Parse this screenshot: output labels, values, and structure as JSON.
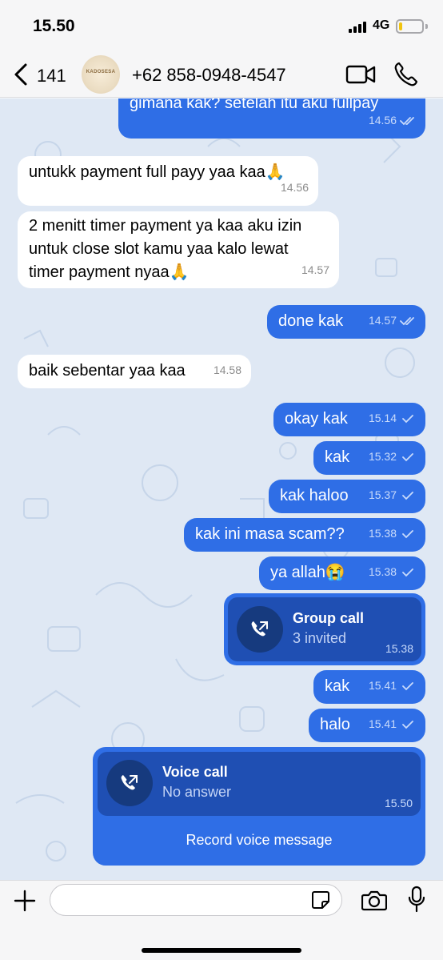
{
  "status": {
    "time": "15.50",
    "network": "4G"
  },
  "header": {
    "back_count": "141",
    "avatar_text": "KADOSESA",
    "contact": "+62 858-0948-4547"
  },
  "messages": [
    {
      "dir": "out",
      "text": "gimana kak? setelah itu aku fullpay",
      "time": "14.56",
      "ticks": "double"
    },
    {
      "dir": "in",
      "text": "untukk payment full payy yaa kaa🙏",
      "time": "14.56"
    },
    {
      "dir": "in",
      "text": "2 menitt timer payment ya kaa aku izin untuk close slot kamu yaa kalo lewat timer payment nyaa🙏",
      "time": "14.57"
    },
    {
      "dir": "out",
      "text": "done kak",
      "time": "14.57",
      "ticks": "double"
    },
    {
      "dir": "in",
      "text": "baik sebentar yaa kaa",
      "time": "14.58"
    },
    {
      "dir": "out",
      "text": "okay kak",
      "time": "15.14",
      "ticks": "single"
    },
    {
      "dir": "out",
      "text": "kak",
      "time": "15.32",
      "ticks": "single"
    },
    {
      "dir": "out",
      "text": "kak haloo",
      "time": "15.37",
      "ticks": "single"
    },
    {
      "dir": "out",
      "text": "kak ini masa scam??",
      "time": "15.38",
      "ticks": "single"
    },
    {
      "dir": "out",
      "text": "ya allah😭",
      "time": "15.38",
      "ticks": "single"
    },
    {
      "dir": "out",
      "text": "kak",
      "time": "15.41",
      "ticks": "single"
    },
    {
      "dir": "out",
      "text": "halo",
      "time": "15.41",
      "ticks": "single"
    }
  ],
  "group_call": {
    "title": "Group call",
    "subtitle": "3 invited",
    "time": "15.38"
  },
  "voice_call": {
    "title": "Voice call",
    "subtitle": "No answer",
    "time": "15.50",
    "record_label": "Record voice message"
  },
  "composer": {
    "placeholder": ""
  },
  "colors": {
    "outgoing": "#2f6ee6",
    "call_inner": "#1f4fb3",
    "call_circle": "#163a7e",
    "chat_bg": "#dfe8f4"
  }
}
